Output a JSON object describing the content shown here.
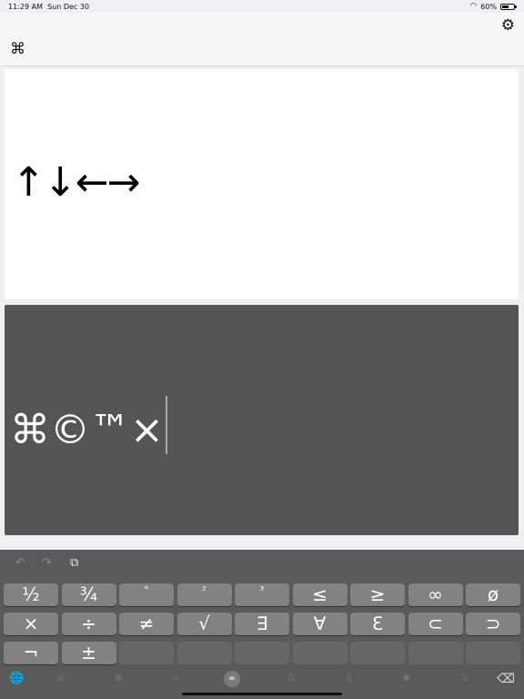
{
  "status": {
    "time": "11:29 AM",
    "date": "Sun Dec 30",
    "battery": "60%",
    "battery_level": 0.6
  },
  "nav": {
    "settings_icon": "⚙",
    "command_icon": "⌘"
  },
  "top_text": "↑↓←→",
  "input_text": "⌘©™×",
  "toolbar": {
    "undo": "↶",
    "redo": "↷",
    "copy": "⧉"
  },
  "keys": {
    "row1": [
      "½",
      "¾",
      "°",
      "²",
      "³",
      "≤",
      "≥",
      "∞",
      "ø"
    ],
    "row2": [
      "×",
      "÷",
      "≠",
      "√",
      "∃",
      "∀",
      "ℇ",
      "⊂",
      "⊃"
    ],
    "row3": [
      "¬",
      "±",
      "",
      "",
      "",
      "",
      "",
      "",
      ""
    ]
  },
  "categories": [
    "⊙",
    "⌘",
    "→",
    "∞",
    "Ω",
    "§",
    "✺",
    "ツ"
  ],
  "bottom": {
    "globe": "🌐",
    "delete": "⌫"
  }
}
